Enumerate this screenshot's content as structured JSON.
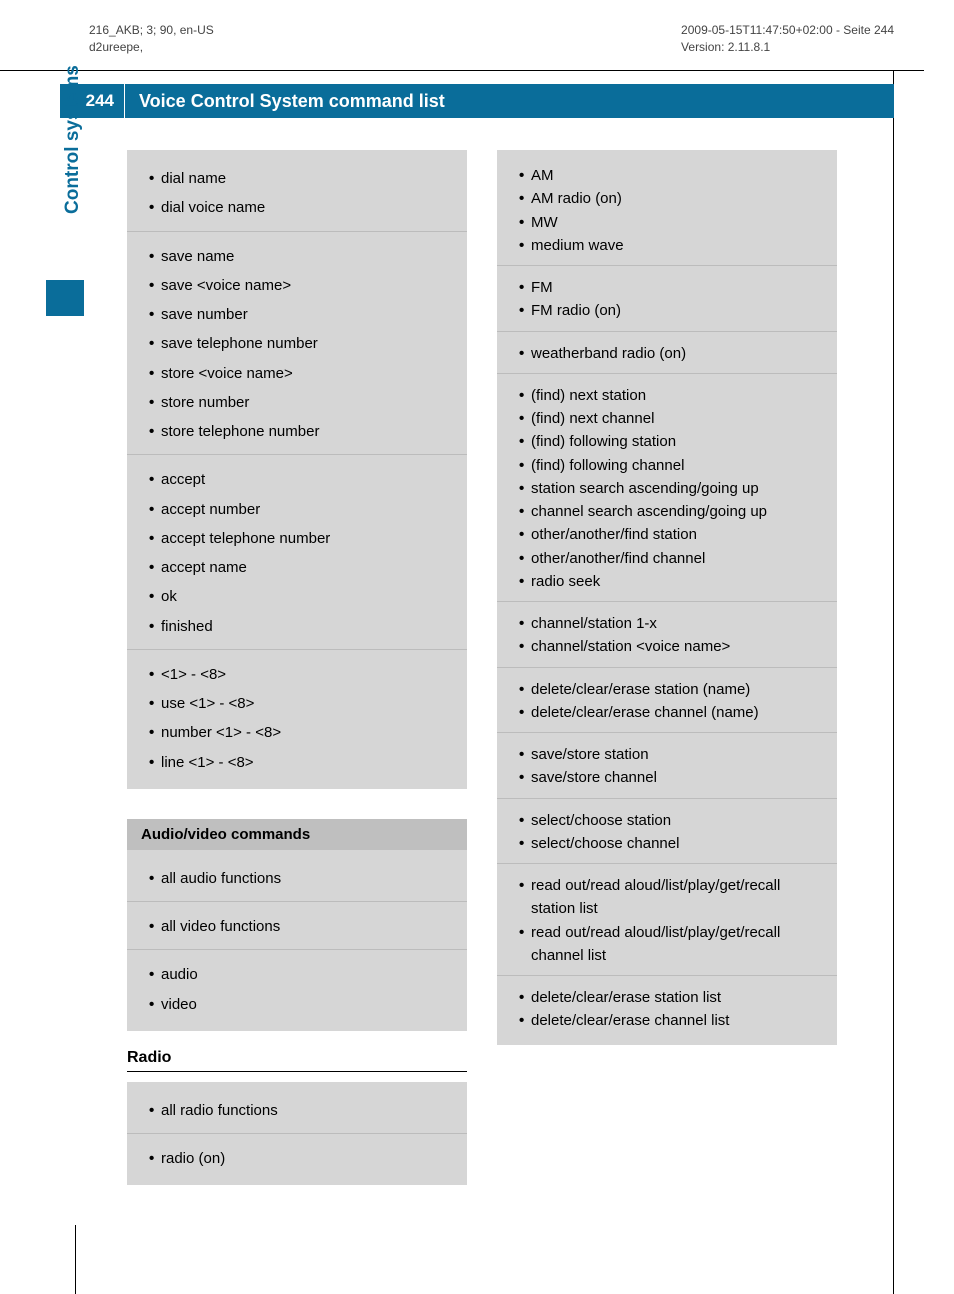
{
  "meta": {
    "left_line1": "216_AKB; 3; 90, en-US",
    "left_line2": "d2ureepe,",
    "right_line1": "2009-05-15T11:47:50+02:00 - Seite 244",
    "right_line2": "Version: 2.11.8.1"
  },
  "page_number": "244",
  "title": "Voice Control System command list",
  "side_tab": "Control systems",
  "left_column": {
    "box1_groups": [
      [
        "dial name",
        "dial voice name"
      ],
      [
        "save name",
        "save <voice name>",
        "save number",
        "save telephone number",
        "store <voice name>",
        "store number",
        "store telephone number"
      ],
      [
        "accept",
        "accept number",
        "accept telephone number",
        "accept name",
        "ok",
        "finished"
      ],
      [
        "<1> - <8>",
        "use <1> - <8>",
        "number <1> - <8>",
        "line <1> - <8>"
      ]
    ],
    "section_header": "Audio/video commands",
    "box2_groups": [
      [
        "all audio functions"
      ],
      [
        "all video functions"
      ],
      [
        "audio",
        "video"
      ]
    ],
    "sub_heading": "Radio",
    "box3_groups": [
      [
        "all radio functions"
      ],
      [
        "radio (on)"
      ]
    ]
  },
  "right_column": {
    "box1_groups": [
      [
        "AM",
        "AM radio (on)",
        "MW",
        "medium wave"
      ],
      [
        "FM",
        "FM radio (on)"
      ],
      [
        "weatherband radio (on)"
      ],
      [
        "(find) next station",
        "(find) next channel",
        "(find) following station",
        "(find) following channel",
        "station search ascending/going up",
        "channel search ascending/going up",
        "other/another/find station",
        "other/another/find channel",
        "radio seek"
      ],
      [
        "channel/station 1-x",
        "channel/station <voice name>"
      ],
      [
        "delete/clear/erase station (name)",
        "delete/clear/erase channel (name)"
      ],
      [
        "save/store station",
        "save/store channel"
      ],
      [
        "select/choose station",
        "select/choose channel"
      ],
      [
        "read out/read aloud/list/play/get/recall station list",
        "read out/read aloud/list/play/get/recall channel list"
      ],
      [
        "delete/clear/erase station list",
        "delete/clear/erase channel list"
      ]
    ]
  }
}
